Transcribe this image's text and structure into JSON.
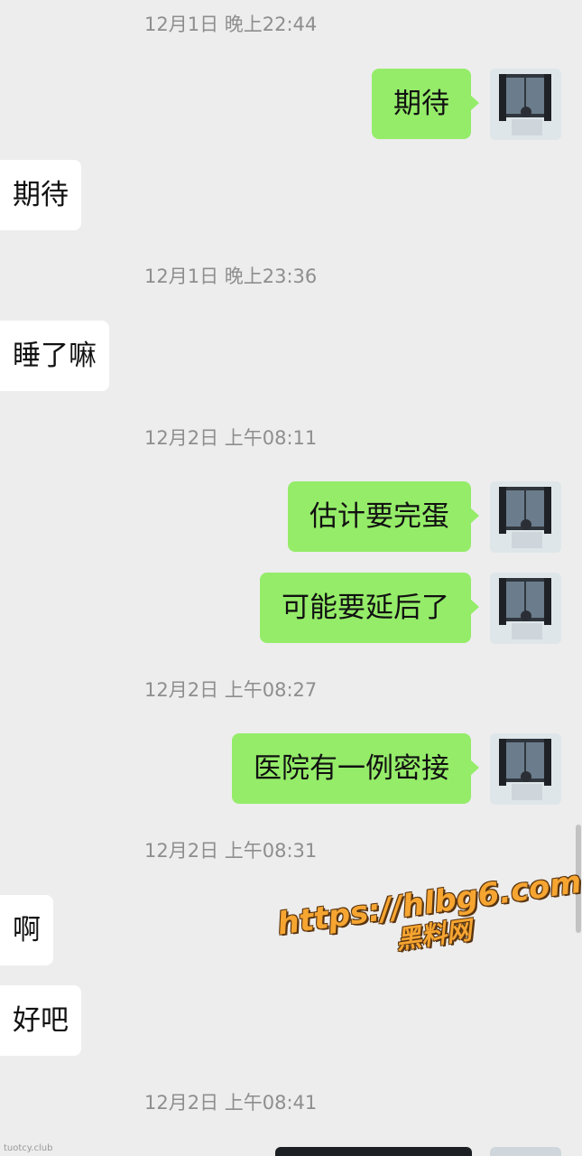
{
  "timestamps": {
    "t1": "12月1日 晚上22:44",
    "t2": "12月1日 晚上23:36",
    "t3": "12月2日 上午08:11",
    "t4": "12月2日 上午08:27",
    "t5": "12月2日 上午08:31",
    "t6": "12月2日 上午08:41"
  },
  "messages": {
    "m1": "期待",
    "m2": "期待",
    "m3": "睡了嘛",
    "m4": "估计要完蛋",
    "m5": "可能要延后了",
    "m6": "医院有一例密接",
    "m7": "啊",
    "m8": "好吧"
  },
  "watermark": {
    "url": "https://hlbg6.com",
    "site": "黑料网"
  },
  "footer_mark": "tuotcy.club",
  "colors": {
    "background": "#ededed",
    "outgoing_bubble": "#95ec69",
    "incoming_bubble": "#ffffff",
    "timestamp_text": "#8e8e8e"
  }
}
